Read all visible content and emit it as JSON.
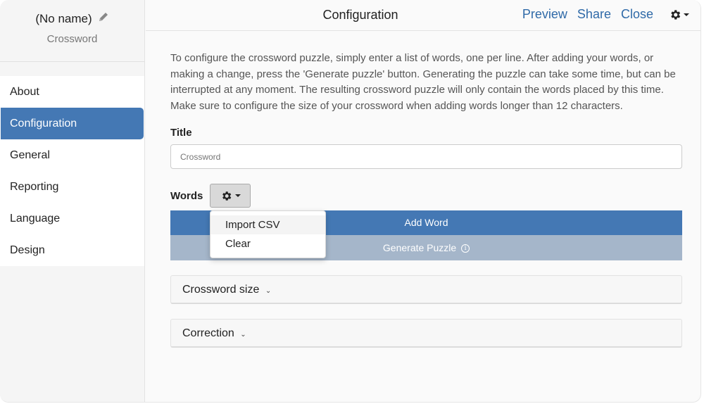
{
  "sidebar": {
    "name": "(No name)",
    "subtitle": "Crossword",
    "items": [
      {
        "label": "About",
        "active": false
      },
      {
        "label": "Configuration",
        "active": true
      },
      {
        "label": "General",
        "active": false
      },
      {
        "label": "Reporting",
        "active": false
      },
      {
        "label": "Language",
        "active": false
      },
      {
        "label": "Design",
        "active": false
      }
    ]
  },
  "header": {
    "title": "Configuration",
    "links": {
      "preview": "Preview",
      "share": "Share",
      "close": "Close"
    },
    "menu_icon": "gear-icon"
  },
  "main": {
    "intro": "To configure the crossword puzzle, simply enter a list of words, one per line. After adding your words, or making a change, press the 'Generate puzzle' button. Generating the puzzle can take some time, but can be interrupted at any moment. The resulting crossword puzzle will only contain the words placed by this time. Make sure to configure the size of your crossword when adding words longer than 12 characters.",
    "title_label": "Title",
    "title_placeholder": "Crossword",
    "words_label": "Words",
    "add_word": "Add Word",
    "generate_puzzle": "Generate Puzzle",
    "panels": [
      {
        "label": "Crossword size"
      },
      {
        "label": "Correction"
      }
    ]
  },
  "dropdown": {
    "items": [
      {
        "label": "Import CSV"
      },
      {
        "label": "Clear"
      }
    ]
  },
  "colors": {
    "accent": "#4478b4",
    "link": "#2f6aa8",
    "generate_bg": "#a5b6ca"
  }
}
